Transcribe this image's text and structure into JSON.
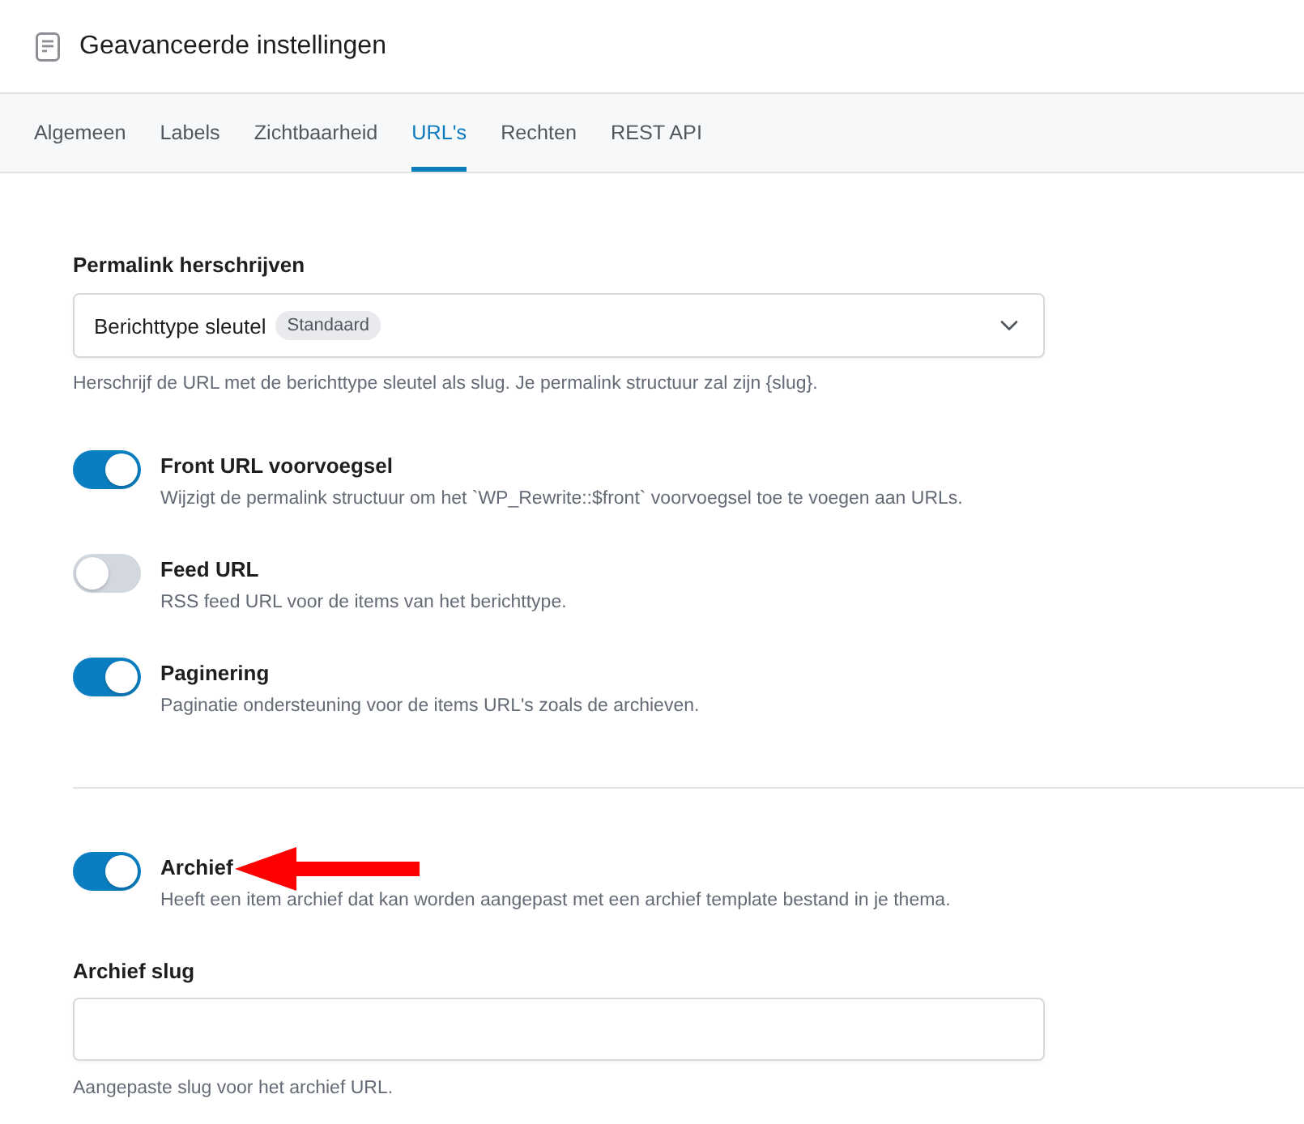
{
  "header": {
    "title": "Geavanceerde instellingen"
  },
  "tabs": [
    {
      "label": "Algemeen",
      "selected": false
    },
    {
      "label": "Labels",
      "selected": false
    },
    {
      "label": "Zichtbaarheid",
      "selected": false
    },
    {
      "label": "URL's",
      "selected": true
    },
    {
      "label": "Rechten",
      "selected": false
    },
    {
      "label": "REST API",
      "selected": false
    }
  ],
  "permalink": {
    "label": "Permalink herschrijven",
    "value": "Berichttype sleutel",
    "badge": "Standaard",
    "help": "Herschrijf de URL met de berichttype sleutel als slug. Je permalink structuur zal zijn {slug}."
  },
  "toggles": [
    {
      "title": "Front URL voorvoegsel",
      "description": "Wijzigt de permalink structuur om het `WP_Rewrite::$front` voorvoegsel toe te voegen aan URLs.",
      "on": true
    },
    {
      "title": "Feed URL",
      "description": "RSS feed URL voor de items van het berichttype.",
      "on": false
    },
    {
      "title": "Paginering",
      "description": "Paginatie ondersteuning voor de items URL's zoals de archieven.",
      "on": true
    }
  ],
  "archive": {
    "toggle": {
      "title": "Archief",
      "description": "Heeft een item archief dat kan worden aangepast met een archief template bestand in je thema.",
      "on": true
    },
    "slug": {
      "label": "Archief slug",
      "help": "Aangepaste slug voor het archief URL."
    }
  }
}
